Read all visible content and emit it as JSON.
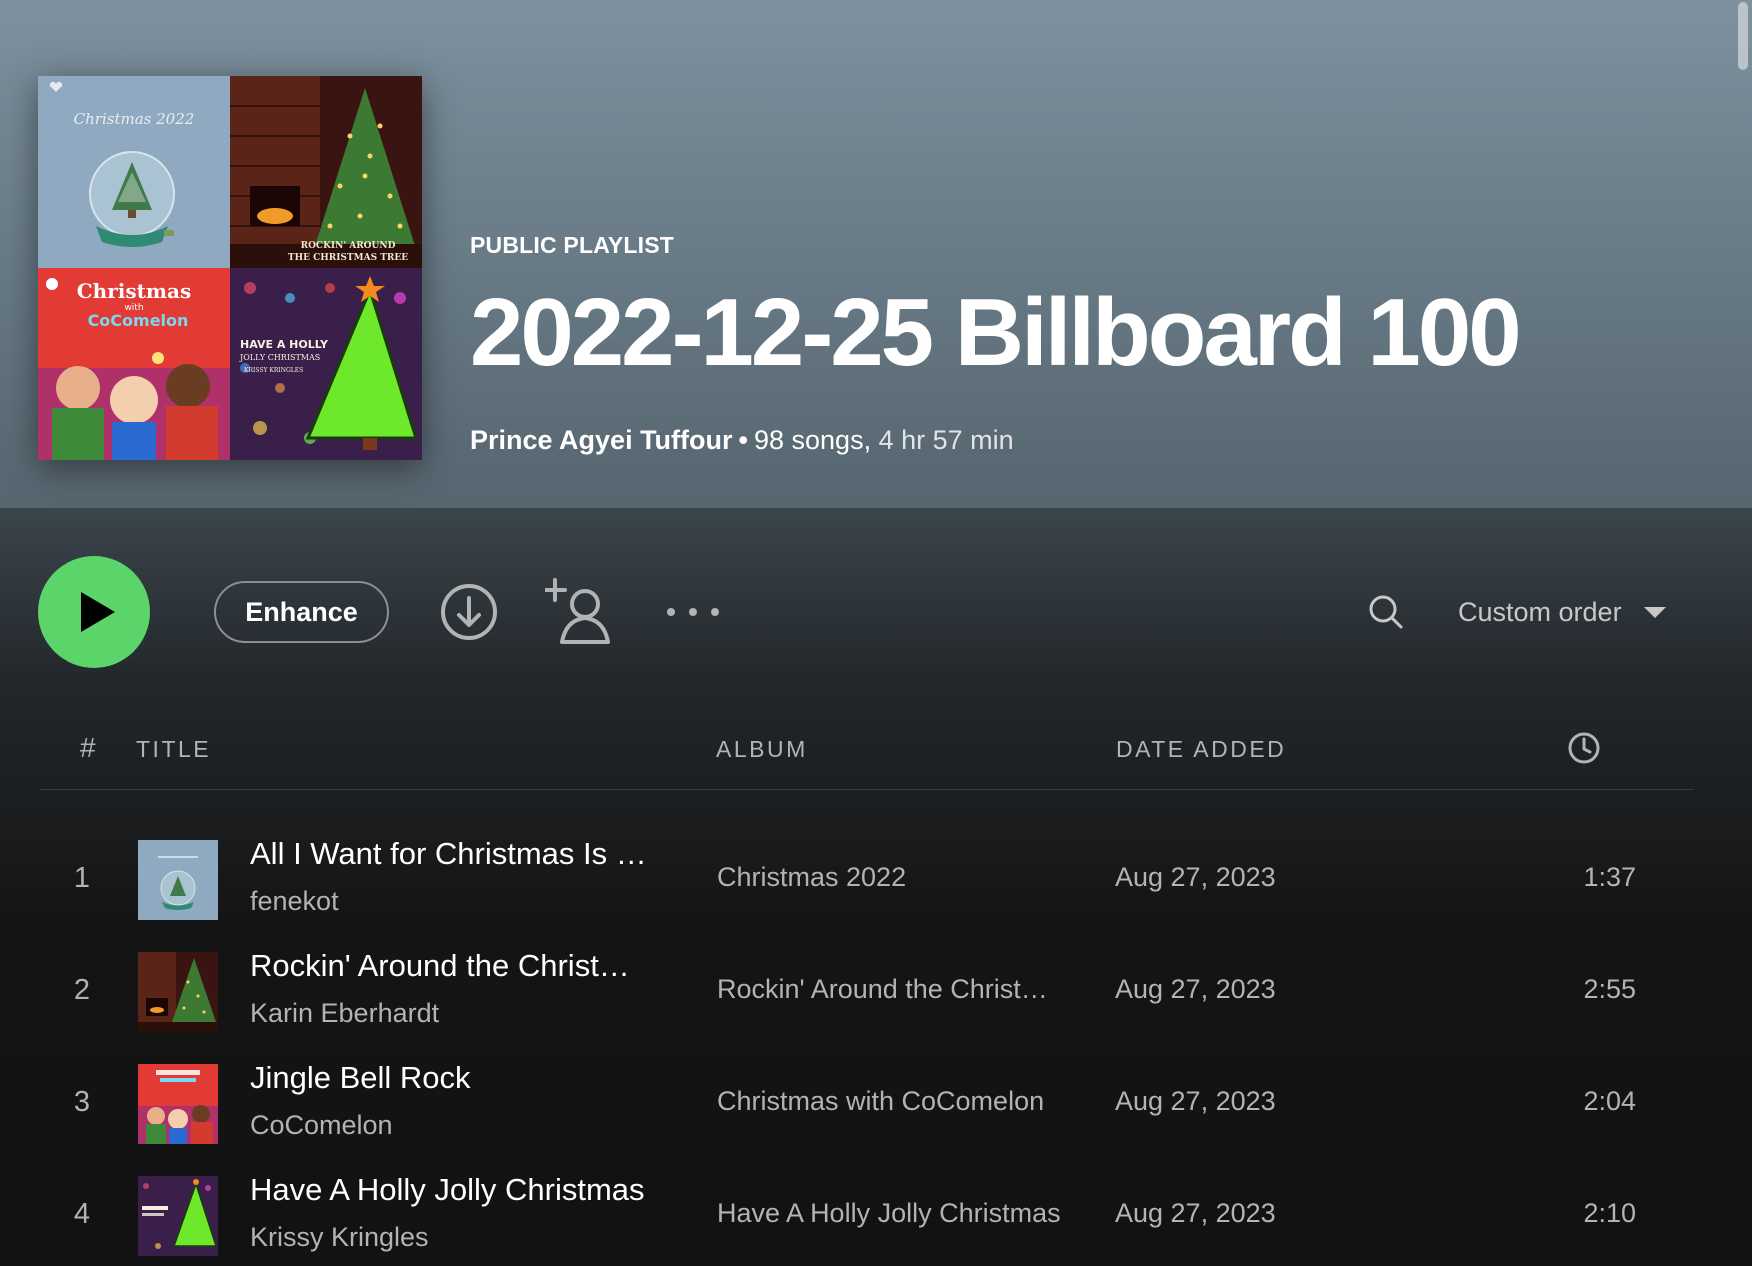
{
  "colors": {
    "accent_green": "#5bd46a",
    "header_top": "#7d919e",
    "background": "#121212",
    "muted_text": "#b3b3b3"
  },
  "header": {
    "type_label": "PUBLIC PLAYLIST",
    "title": "2022-12-25 Billboard 100",
    "owner": "Prince Agyei Tuffour",
    "separator": "•",
    "song_count": "98 songs,",
    "duration": "4 hr 57 min",
    "cover_tiles": [
      {
        "name": "christmas-2022-cover",
        "text": "Christmas 2022"
      },
      {
        "name": "rockin-around-cover",
        "text_line1": "ROCKIN' AROUND",
        "text_line2": "THE CHRISTMAS TREE"
      },
      {
        "name": "cocomelon-cover",
        "text_line1": "Christmas",
        "text_line2": "with",
        "text_line3": "CoComelon"
      },
      {
        "name": "holly-jolly-cover",
        "text_line1": "HAVE A HOLLY",
        "text_line2": "JOLLY CHRISTMAS",
        "text_line3": "KRISSY KRINGLES"
      }
    ]
  },
  "actions": {
    "play_icon": "play-icon",
    "enhance_label": "Enhance",
    "download_icon": "download-icon",
    "add_user_icon": "add-user-icon",
    "more_icon": "more-icon",
    "search_icon": "search-icon",
    "sort_label": "Custom order",
    "sort_caret_icon": "caret-down-icon"
  },
  "table": {
    "columns": {
      "number": "#",
      "title": "TITLE",
      "album": "ALBUM",
      "date_added": "DATE ADDED",
      "duration_icon": "clock-icon"
    },
    "rows": [
      {
        "number": "1",
        "title": "All I Want for Christmas Is …",
        "artist": "fenekot",
        "album": "Christmas 2022",
        "date_added": "Aug 27, 2023",
        "duration": "1:37",
        "thumb": "christmas-2022"
      },
      {
        "number": "2",
        "title": "Rockin' Around the Christ…",
        "artist": "Karin Eberhardt",
        "album": "Rockin' Around the Christ…",
        "date_added": "Aug 27, 2023",
        "duration": "2:55",
        "thumb": "rockin-around"
      },
      {
        "number": "3",
        "title": "Jingle Bell Rock",
        "artist": "CoComelon",
        "album": "Christmas with CoComelon",
        "date_added": "Aug 27, 2023",
        "duration": "2:04",
        "thumb": "cocomelon"
      },
      {
        "number": "4",
        "title": "Have A Holly Jolly Christmas",
        "artist": "Krissy Kringles",
        "album": "Have A Holly Jolly Christmas",
        "date_added": "Aug 27, 2023",
        "duration": "2:10",
        "thumb": "holly-jolly"
      }
    ]
  }
}
